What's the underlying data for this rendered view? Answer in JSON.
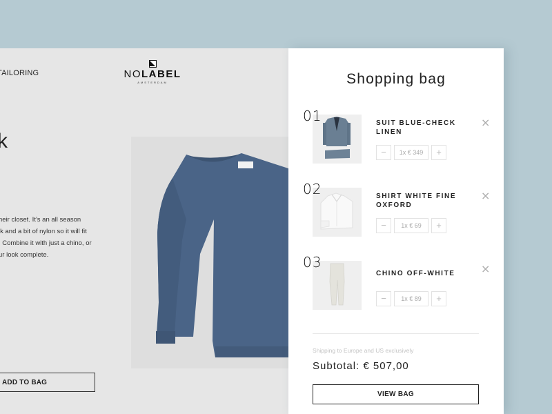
{
  "page": {
    "nav_link": "TAILORING",
    "brand": {
      "name_thin": "NO",
      "name_bold": "LABEL",
      "sub": "AMSTERDAM"
    },
    "product_title": "k",
    "description_lines": [
      "heir closet. It’s an all season",
      "lk and a bit of nylon so it will fit",
      ". Combine it with just a chino, or",
      "ur look complete."
    ],
    "add_to_bag_label": "ADD TO BAG",
    "product_image": "blue-crewneck-sweater"
  },
  "drawer": {
    "title": "Shopping bag",
    "items": [
      {
        "num": "01",
        "name": "SUIT BLUE-CHECK LINEN",
        "qty_price": "1x € 349",
        "image": "suit-thumbnail"
      },
      {
        "num": "02",
        "name": "SHIRT WHITE FINE OXFORD",
        "qty_price": "1x € 69",
        "image": "shirt-thumbnail"
      },
      {
        "num": "03",
        "name": "CHINO OFF-WHITE",
        "qty_price": "1x € 89",
        "image": "chino-thumbnail"
      }
    ],
    "minus_label": "−",
    "plus_label": "+",
    "remove_label": "×",
    "shipping_note": "Shipping to Europe and US exclusively",
    "subtotal": "Subtotal: € 507,00",
    "view_bag_label": "VIEW BAG"
  },
  "colors": {
    "background": "#b5cad2",
    "page_bg": "#e6e6e6",
    "drawer_bg": "#ffffff",
    "sweater": "#4a6487"
  }
}
